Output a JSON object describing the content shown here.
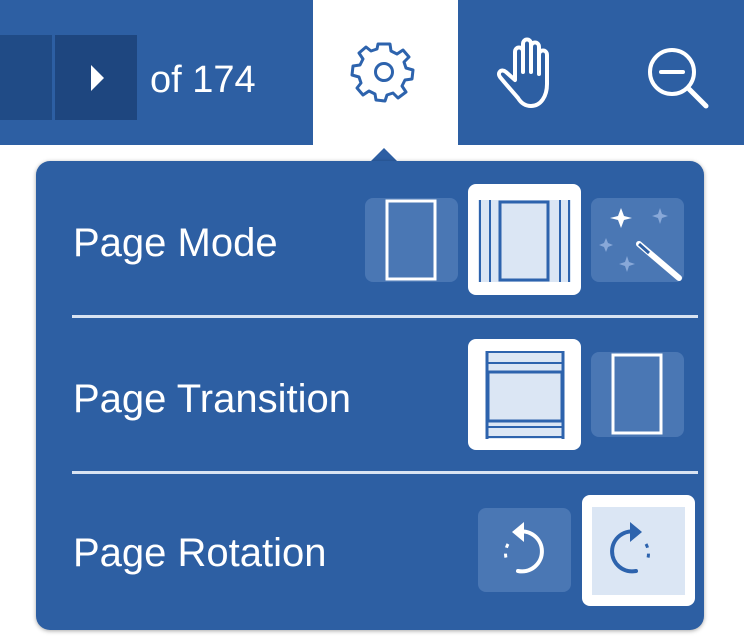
{
  "toolbar": {
    "page_of_label": "of 174",
    "tools": [
      {
        "name": "settings",
        "icon": "gear-icon",
        "active": true
      },
      {
        "name": "pan",
        "icon": "hand-icon",
        "active": false
      },
      {
        "name": "zoom-out",
        "icon": "zoom-out-icon",
        "active": false
      }
    ]
  },
  "settings_panel": {
    "page_mode": {
      "label": "Page Mode",
      "options": [
        {
          "name": "single-page",
          "icon": "single-page-icon",
          "selected": false
        },
        {
          "name": "continuous",
          "icon": "continuous-pages-icon",
          "selected": true
        },
        {
          "name": "auto",
          "icon": "magic-wand-icon",
          "selected": false
        }
      ]
    },
    "page_transition": {
      "label": "Page Transition",
      "options": [
        {
          "name": "scroll",
          "icon": "vertical-scroll-transition-icon",
          "selected": true
        },
        {
          "name": "page",
          "icon": "single-page-transition-icon",
          "selected": false
        }
      ]
    },
    "page_rotation": {
      "label": "Page Rotation",
      "options": [
        {
          "name": "rotate-counterclockwise",
          "icon": "rotate-left-icon",
          "selected": false
        },
        {
          "name": "rotate-clockwise",
          "icon": "rotate-right-icon",
          "selected": true
        }
      ]
    }
  },
  "colors": {
    "primary": "#2d5fa3",
    "dark": "#1e467f",
    "selected_bg": "#ffffff",
    "selected_icon": "#2d63ad",
    "unselected_bg": "#4a77b4"
  }
}
